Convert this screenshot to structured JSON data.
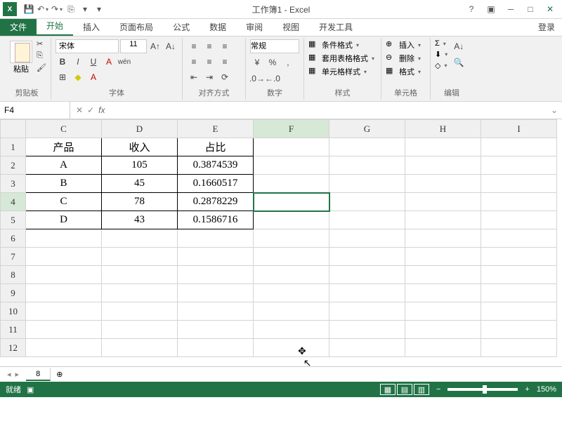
{
  "title": "工作簿1 - Excel",
  "login": "登录",
  "tabs": {
    "file": "文件",
    "home": "开始",
    "insert": "插入",
    "layout": "页面布局",
    "formula": "公式",
    "data": "数据",
    "review": "审阅",
    "view": "视图",
    "dev": "开发工具"
  },
  "ribbon": {
    "clipboard": {
      "label": "剪贴板",
      "paste": "粘贴"
    },
    "font": {
      "label": "字体",
      "name": "宋体",
      "size": "11",
      "bold": "B",
      "italic": "I",
      "underline": "U",
      "wen": "wén"
    },
    "align": {
      "label": "对齐方式"
    },
    "number": {
      "label": "数字",
      "format": "常规"
    },
    "styles": {
      "label": "样式",
      "cond": "条件格式",
      "table": "套用表格格式",
      "cell": "单元格样式"
    },
    "cells": {
      "label": "单元格",
      "insert": "插入",
      "delete": "删除",
      "format": "格式"
    },
    "edit": {
      "label": "编辑"
    }
  },
  "namebox": "F4",
  "fx": "fx",
  "columns": [
    "C",
    "D",
    "E",
    "F",
    "G",
    "H",
    "I"
  ],
  "rows": [
    "1",
    "2",
    "3",
    "4",
    "5",
    "6",
    "7",
    "8",
    "9",
    "10",
    "11",
    "12"
  ],
  "cells": {
    "C1": "产品",
    "D1": "收入",
    "E1": "占比",
    "C2": "A",
    "D2": "105",
    "E2": "0.3874539",
    "C3": "B",
    "D3": "45",
    "E3": "0.1660517",
    "C4": "C",
    "D4": "78",
    "E4": "0.2878229",
    "C5": "D",
    "D5": "43",
    "E5": "0.1586716"
  },
  "active_cell": "F4",
  "sheet_name": "8",
  "status": {
    "ready": "就绪",
    "zoom": "150%",
    "plus": "+",
    "minus": "−"
  }
}
